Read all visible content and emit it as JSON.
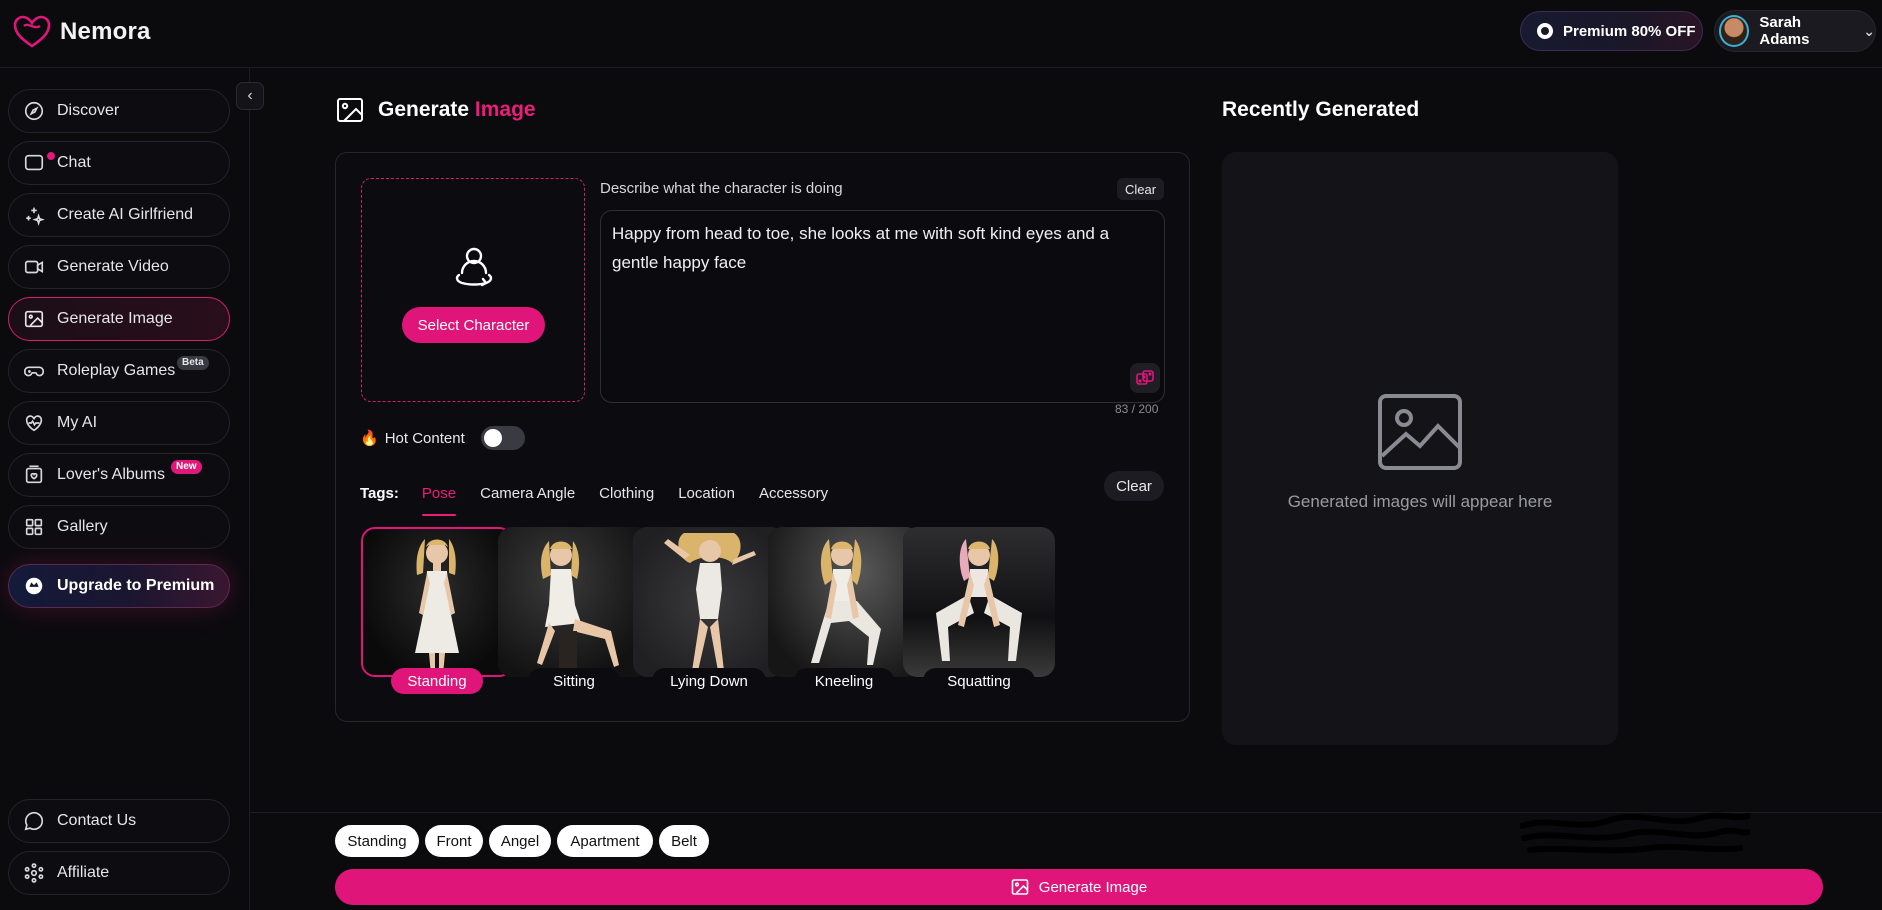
{
  "app": {
    "name": "Nemora"
  },
  "topbar": {
    "premium_label": "Premium 80% OFF",
    "user_name": "Sarah Adams"
  },
  "sidebar": {
    "items": [
      {
        "label": "Discover",
        "icon": "compass-icon"
      },
      {
        "label": "Chat",
        "icon": "chat-icon"
      },
      {
        "label": "Create AI Girlfriend",
        "icon": "sparkles-icon"
      },
      {
        "label": "Generate Video",
        "icon": "video-icon"
      },
      {
        "label": "Generate Image",
        "icon": "image-icon",
        "active": true
      },
      {
        "label": "Roleplay Games",
        "icon": "gamepad-icon",
        "badge": "Beta"
      },
      {
        "label": "My AI",
        "icon": "heart-pulse-icon"
      },
      {
        "label": "Lover's Albums",
        "icon": "album-icon",
        "badge": "New"
      },
      {
        "label": "Gallery",
        "icon": "grid-icon"
      },
      {
        "label": "Upgrade to Premium",
        "icon": "premium-icon"
      }
    ],
    "footer": [
      {
        "label": "Contact Us",
        "icon": "message-circle-icon"
      },
      {
        "label": "Affiliate",
        "icon": "network-icon"
      }
    ]
  },
  "generate": {
    "title_prefix": "Generate",
    "title_accent": "Image",
    "select_character_label": "Select Character",
    "describe_label": "Describe what the character is doing",
    "clear_label": "Clear",
    "prompt_text": "Happy from head to toe, she looks at me with soft kind eyes and a gentle happy face",
    "char_count": "83 / 200",
    "hot_content_label": "Hot Content",
    "hot_content_enabled": false,
    "tags_label": "Tags:",
    "tag_tabs": [
      "Pose",
      "Camera Angle",
      "Clothing",
      "Location",
      "Accessory"
    ],
    "active_tab": "Pose",
    "tags_clear_label": "Clear",
    "poses": [
      "Standing",
      "Sitting",
      "Lying Down",
      "Kneeling",
      "Squatting"
    ],
    "selected_pose": "Standing"
  },
  "recent": {
    "title": "Recently Generated",
    "empty_text": "Generated images will appear here"
  },
  "bottom": {
    "chips": [
      "Standing",
      "Front",
      "Angel",
      "Apartment",
      "Belt"
    ],
    "generate_button_label": "Generate Image"
  },
  "colors": {
    "accent": "#e0157a",
    "background": "#0b0b0e",
    "panel": "#141418"
  }
}
